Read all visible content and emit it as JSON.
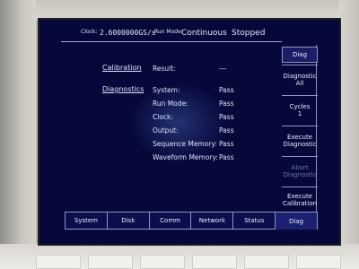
{
  "header": {
    "clock_label": "Clock:",
    "clock_value": "2.6000000GS/s",
    "run_mode_label": "Run Mode:",
    "run_mode_value": "Continuous",
    "status": "Stopped"
  },
  "sections": {
    "calibration": {
      "title": "Calibration",
      "result_label": "Result:",
      "result_value": "---"
    },
    "diagnostics": {
      "title": "Diagnostics",
      "items": [
        {
          "label": "System:",
          "value": "Pass"
        },
        {
          "label": "Run Mode:",
          "value": "Pass"
        },
        {
          "label": "Clock:",
          "value": "Pass"
        },
        {
          "label": "Output:",
          "value": "Pass"
        },
        {
          "label": "Sequence Memory:",
          "value": "Pass"
        },
        {
          "label": "Waveform Memory:",
          "value": "Pass"
        }
      ]
    }
  },
  "side_menu": {
    "title": "Diag",
    "buttons": [
      {
        "line1": "Diagnostic",
        "line2": "All",
        "enabled": true
      },
      {
        "line1": "Cycles",
        "line2": "1",
        "enabled": true
      },
      {
        "line1": "Execute",
        "line2": "Diagnostic",
        "enabled": true
      },
      {
        "line1": "Abort",
        "line2": "Diagnostic",
        "enabled": false
      },
      {
        "line1": "Execute",
        "line2": "Calibration",
        "enabled": true
      }
    ]
  },
  "tabs": [
    "System",
    "Disk",
    "Comm",
    "Network",
    "Status",
    "Diag"
  ],
  "active_tab": "Diag"
}
